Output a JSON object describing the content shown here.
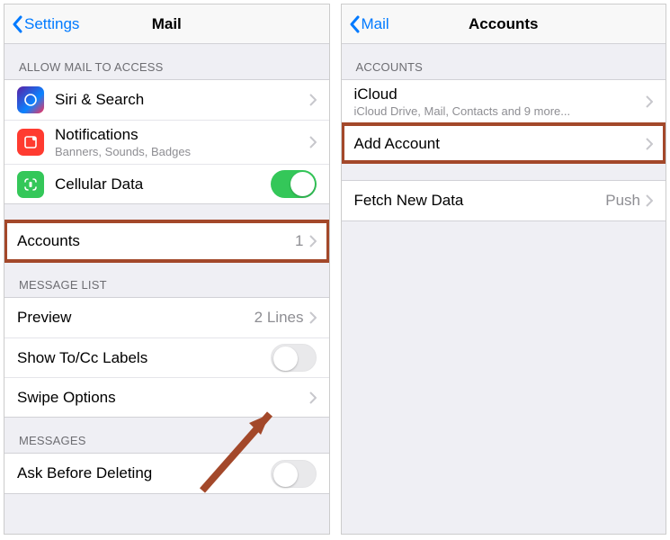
{
  "left": {
    "back_label": "Settings",
    "title": "Mail",
    "sections": {
      "access_header": "ALLOW MAIL TO ACCESS",
      "siri_label": "Siri & Search",
      "notifications_label": "Notifications",
      "notifications_sub": "Banners, Sounds, Badges",
      "cellular_label": "Cellular Data",
      "accounts_label": "Accounts",
      "accounts_count": "1",
      "msglist_header": "MESSAGE LIST",
      "preview_label": "Preview",
      "preview_detail": "2 Lines",
      "tocc_label": "Show To/Cc Labels",
      "swipe_label": "Swipe Options",
      "messages_header": "MESSAGES",
      "askdel_label": "Ask Before Deleting"
    }
  },
  "right": {
    "back_label": "Mail",
    "title": "Accounts",
    "accounts_header": "ACCOUNTS",
    "icloud_label": "iCloud",
    "icloud_sub": "iCloud Drive, Mail, Contacts and 9 more...",
    "add_label": "Add Account",
    "fetch_label": "Fetch New Data",
    "fetch_detail": "Push"
  }
}
